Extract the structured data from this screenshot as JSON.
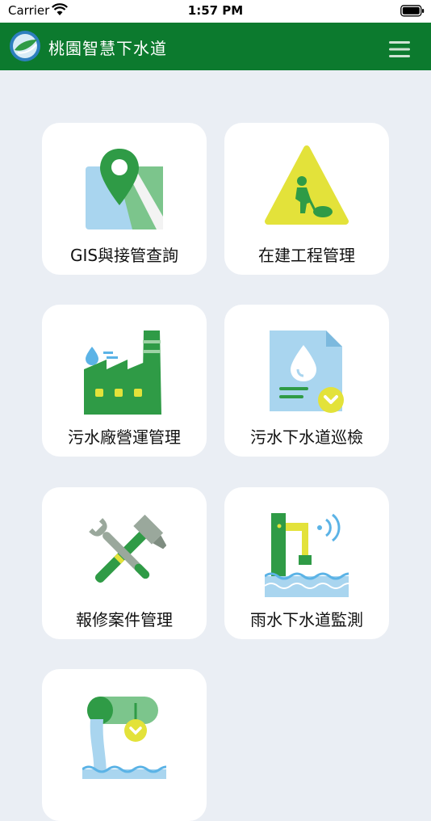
{
  "status_bar": {
    "carrier": "Carrier",
    "time": "1:57 PM"
  },
  "header": {
    "title": "桃園智慧下水道"
  },
  "tiles": [
    {
      "label": "GIS與接管查詢",
      "icon": "map-pin-icon"
    },
    {
      "label": "在建工程管理",
      "icon": "construction-sign-icon"
    },
    {
      "label": "污水廠營運管理",
      "icon": "factory-icon"
    },
    {
      "label": "污水下水道巡檢",
      "icon": "document-water-drop-icon"
    },
    {
      "label": "報修案件管理",
      "icon": "wrench-hammer-icon"
    },
    {
      "label": "雨水下水道監測",
      "icon": "water-level-sensor-icon"
    },
    {
      "label": "",
      "icon": "pipe-outflow-icon"
    }
  ],
  "colors": {
    "brand_green": "#0c7a2e",
    "background": "#eaeef4",
    "tile": "#ffffff"
  }
}
